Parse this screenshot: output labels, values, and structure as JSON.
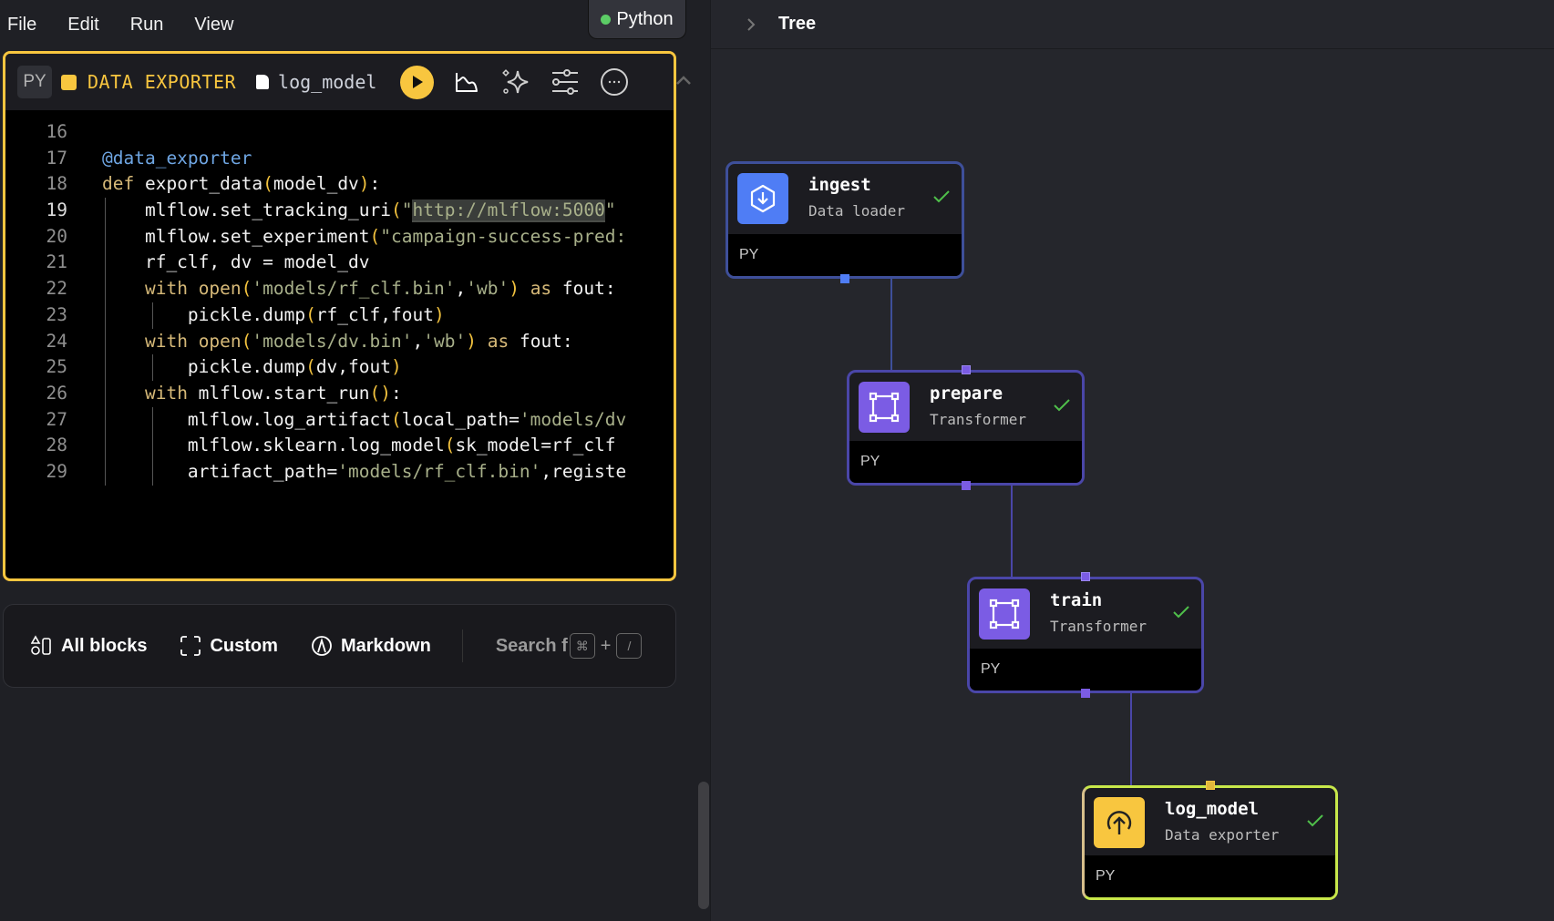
{
  "menubar": {
    "items": [
      "File",
      "Edit",
      "Run",
      "View"
    ]
  },
  "kernel": {
    "label": "Python",
    "status_color": "#5ccd66"
  },
  "editor": {
    "language_badge": "PY",
    "block_type": "DATA EXPORTER",
    "block_name": "log_model",
    "accent_color": "#f8c63f",
    "current_line": 19,
    "lines": [
      {
        "n": 16,
        "html": ""
      },
      {
        "n": 17,
        "html": "<span class='dec'>@data_exporter</span>"
      },
      {
        "n": 18,
        "html": "<span class='k'>def</span> export_data<span class='p'>(</span>model_dv<span class='p'>)</span>:"
      },
      {
        "n": 19,
        "html": "    mlflow.set_tracking_uri<span class='p'>(</span><span class='s'>\"<span class='hl'>http://mlflow:5000</span>\"</span>"
      },
      {
        "n": 20,
        "html": "    mlflow.set_experiment<span class='p'>(</span><span class='s'>\"campaign-success-pred:</span>"
      },
      {
        "n": 21,
        "html": "    rf_clf, dv = model_dv"
      },
      {
        "n": 22,
        "html": "    <span class='k'>with</span> <span class='k'>open</span><span class='p'>(</span><span class='s'>'models/rf_clf.bin'</span>,<span class='s'>'wb'</span><span class='p'>)</span> <span class='k'>as</span> fout:"
      },
      {
        "n": 23,
        "html": "        pickle.dump<span class='p'>(</span>rf_clf,fout<span class='p'>)</span>"
      },
      {
        "n": 24,
        "html": "    <span class='k'>with</span> <span class='k'>open</span><span class='p'>(</span><span class='s'>'models/dv.bin'</span>,<span class='s'>'wb'</span><span class='p'>)</span> <span class='k'>as</span> fout:"
      },
      {
        "n": 25,
        "html": "        pickle.dump<span class='p'>(</span>dv,fout<span class='p'>)</span>"
      },
      {
        "n": 26,
        "html": "    <span class='k'>with</span> mlflow.start_run<span class='p'>()</span>:"
      },
      {
        "n": 27,
        "html": "        mlflow.log_artifact<span class='p'>(</span>local_path=<span class='s'>'models/dv</span>"
      },
      {
        "n": 28,
        "html": "        mlflow.sklearn.log_model<span class='p'>(</span>sk_model=rf_clf"
      },
      {
        "n": 29,
        "html": "        artifact_path=<span class='s'>'models/rf_clf.bin'</span>,registe"
      }
    ]
  },
  "blockbar": {
    "all_blocks": "All blocks",
    "custom": "Custom",
    "markdown": "Markdown",
    "search": "Search f",
    "shortcut_key1": "⌘",
    "shortcut_plus": "+",
    "shortcut_key2": "/"
  },
  "tree": {
    "title": "Tree",
    "nodes": [
      {
        "name": "ingest",
        "type": "Data loader",
        "lang": "PY",
        "status": "success",
        "color": "#4f7df5"
      },
      {
        "name": "prepare",
        "type": "Transformer",
        "lang": "PY",
        "status": "success",
        "color": "#7b5ce4"
      },
      {
        "name": "train",
        "type": "Transformer",
        "lang": "PY",
        "status": "success",
        "color": "#7b5ce4"
      },
      {
        "name": "log_model",
        "type": "Data exporter",
        "lang": "PY",
        "status": "success",
        "color": "#f8c63f"
      }
    ]
  }
}
